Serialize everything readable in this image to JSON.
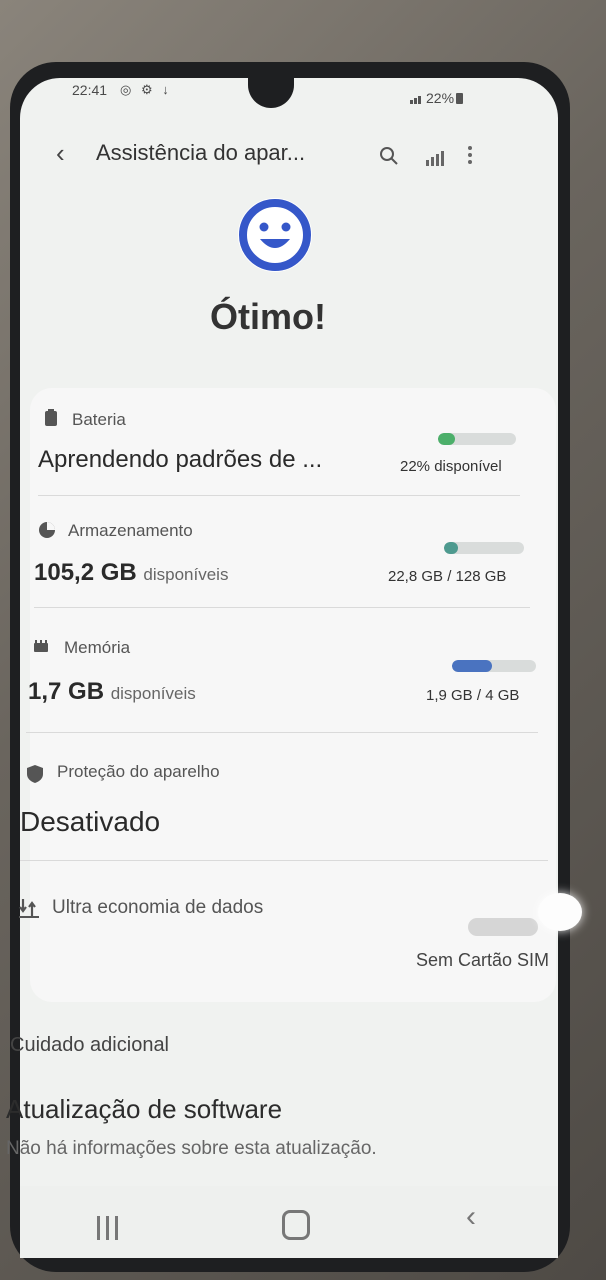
{
  "status_bar": {
    "time": "22:41",
    "left_icons": "◎ ⚙ ↓",
    "battery": "22%"
  },
  "app_bar": {
    "title": "Assistência do apar...",
    "back_icon": "chevron-left-icon",
    "search_icon": "search-icon",
    "stats_icon": "bar-chart-icon",
    "more_icon": "more-vert-icon"
  },
  "summary": {
    "face_icon": "smiley-face-icon",
    "headline": "Ótimo!"
  },
  "battery": {
    "label": "Bateria",
    "value": "Aprendendo padrões de ...",
    "detail": "22% disponível",
    "level": 0.22,
    "color": "#4caf6a"
  },
  "storage": {
    "label": "Armazenamento",
    "value": "105,2 GB",
    "unit": "disponíveis",
    "detail": "22,8 GB / 128 GB",
    "level": 0.18,
    "color": "#4e9a8f"
  },
  "memory": {
    "label": "Memória",
    "value": "1,7 GB",
    "unit": "disponíveis",
    "detail": "1,9 GB / 4 GB",
    "level": 0.48,
    "color": "#4a73c0"
  },
  "protection": {
    "label": "Proteção do aparelho",
    "value": "Desativado"
  },
  "data_saver": {
    "label": "Ultra economia de dados",
    "status": "Sem Cartão SIM",
    "enabled": false
  },
  "extra_care": {
    "title": "Cuidado adicional"
  },
  "software_update": {
    "title": "Atualização de software",
    "subtitle": "Não há informações sobre esta atualização."
  },
  "nav": {
    "recents": "recents-icon",
    "home": "home-icon",
    "back": "back-icon"
  }
}
